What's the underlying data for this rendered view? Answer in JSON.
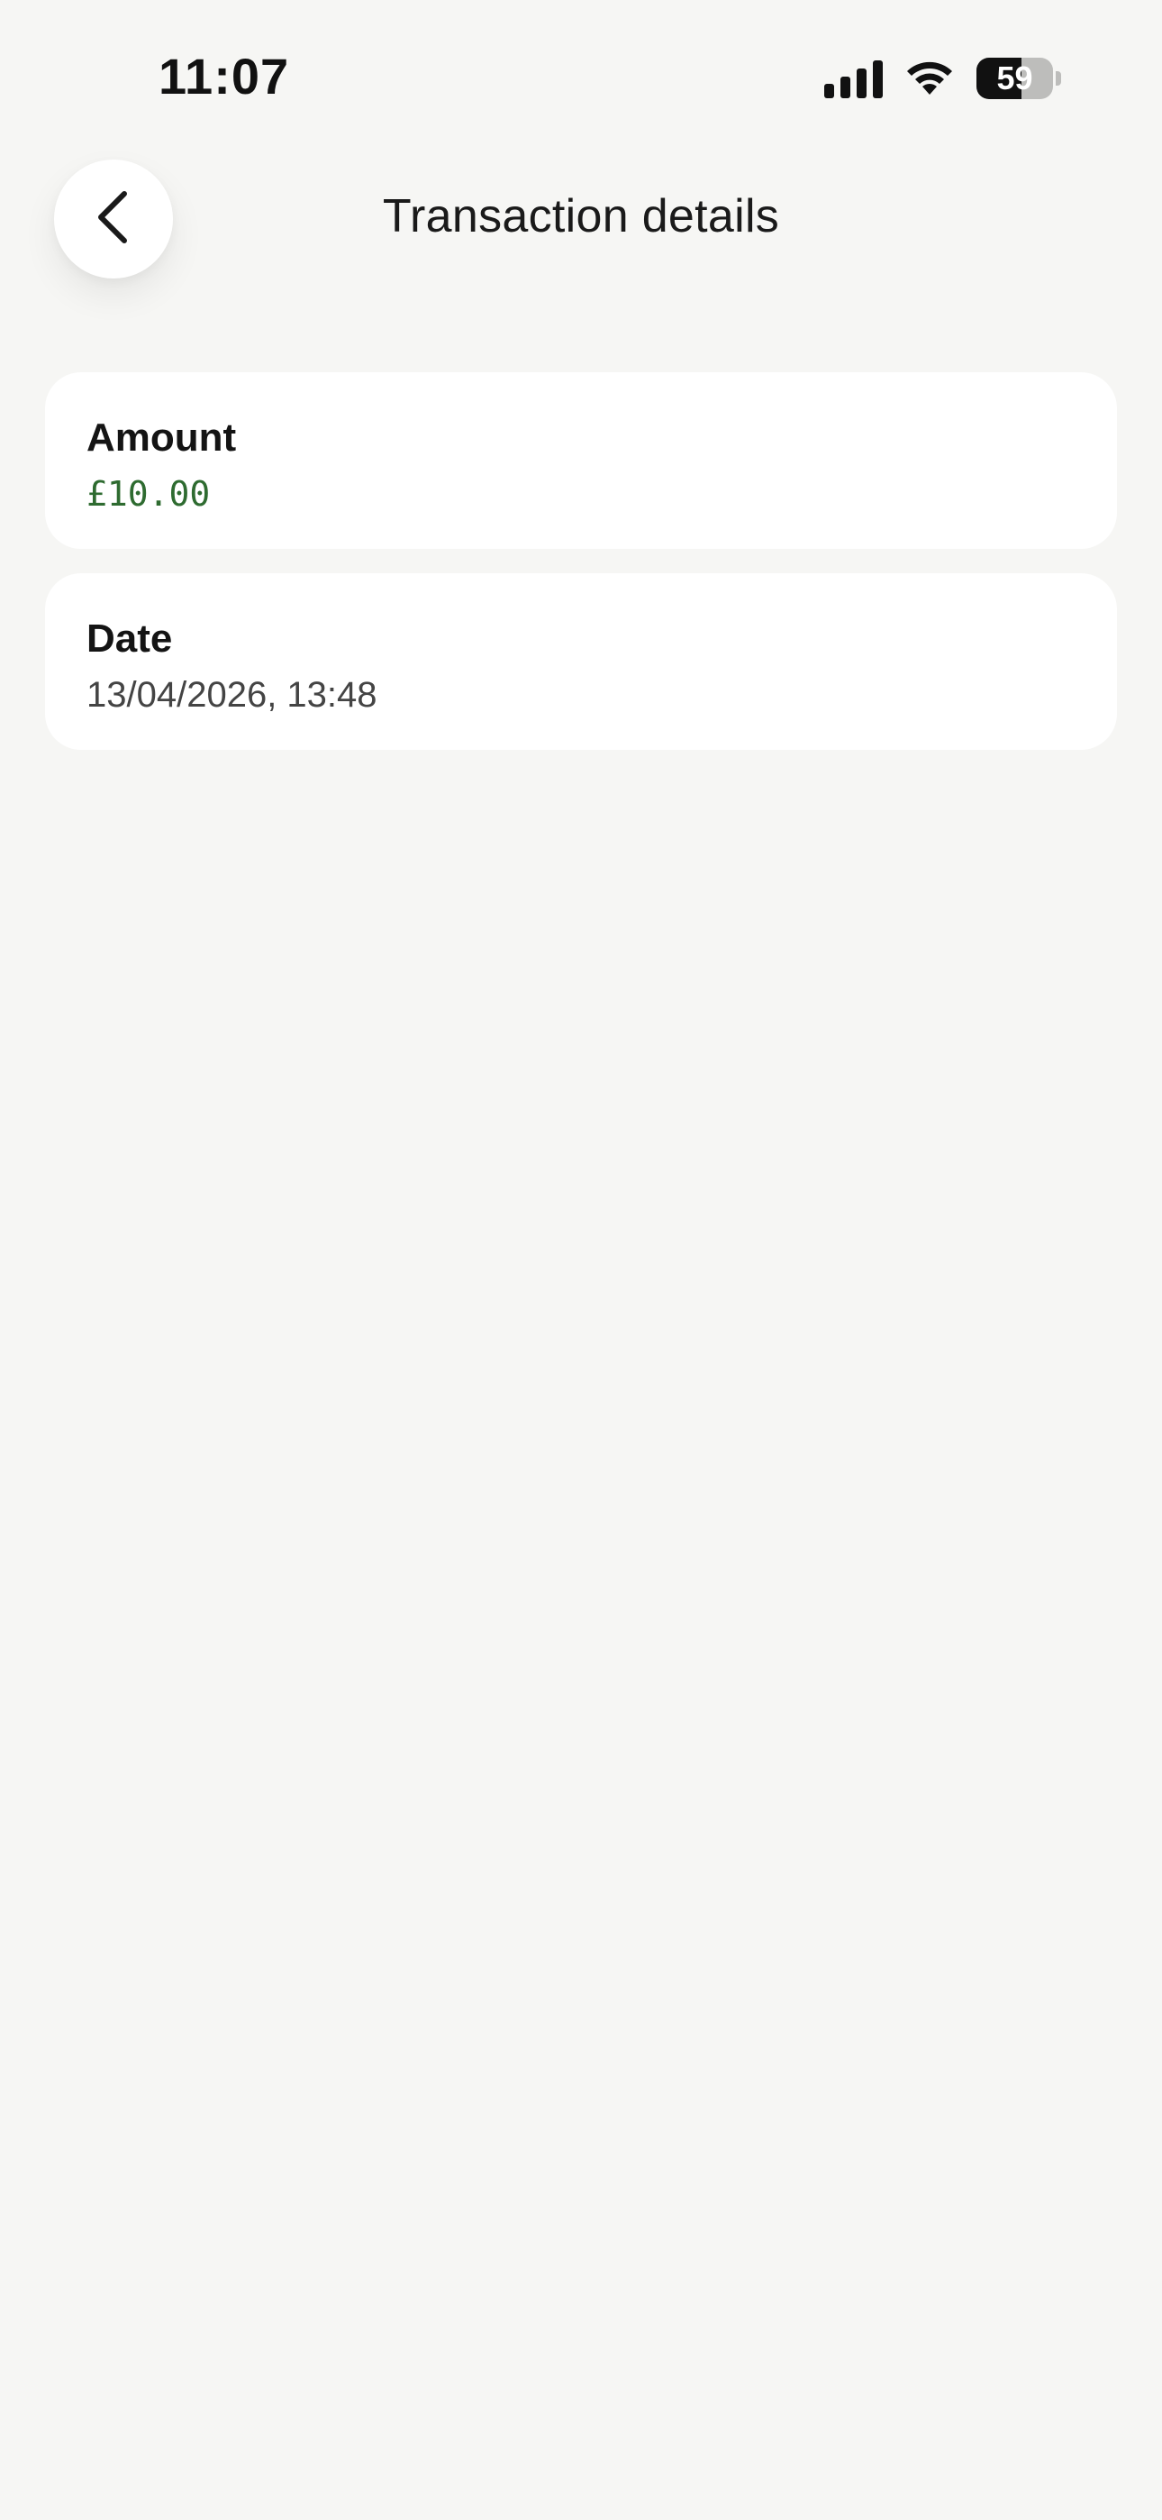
{
  "status_bar": {
    "time": "11:07",
    "battery_level": "59",
    "battery_fraction": 0.59,
    "icons": [
      "signal-icon",
      "wifi-icon",
      "battery-icon"
    ]
  },
  "header": {
    "title": "Transaction details",
    "back_icon": "chevron-left-icon"
  },
  "details": {
    "amount": {
      "label": "Amount",
      "value": "£10.00",
      "color": "#2e6b30"
    },
    "date": {
      "label": "Date",
      "value": "13/04/2026, 13:48"
    }
  },
  "colors": {
    "background": "#f6f6f4",
    "card": "#ffffff",
    "positive_amount": "#2e6b30"
  }
}
